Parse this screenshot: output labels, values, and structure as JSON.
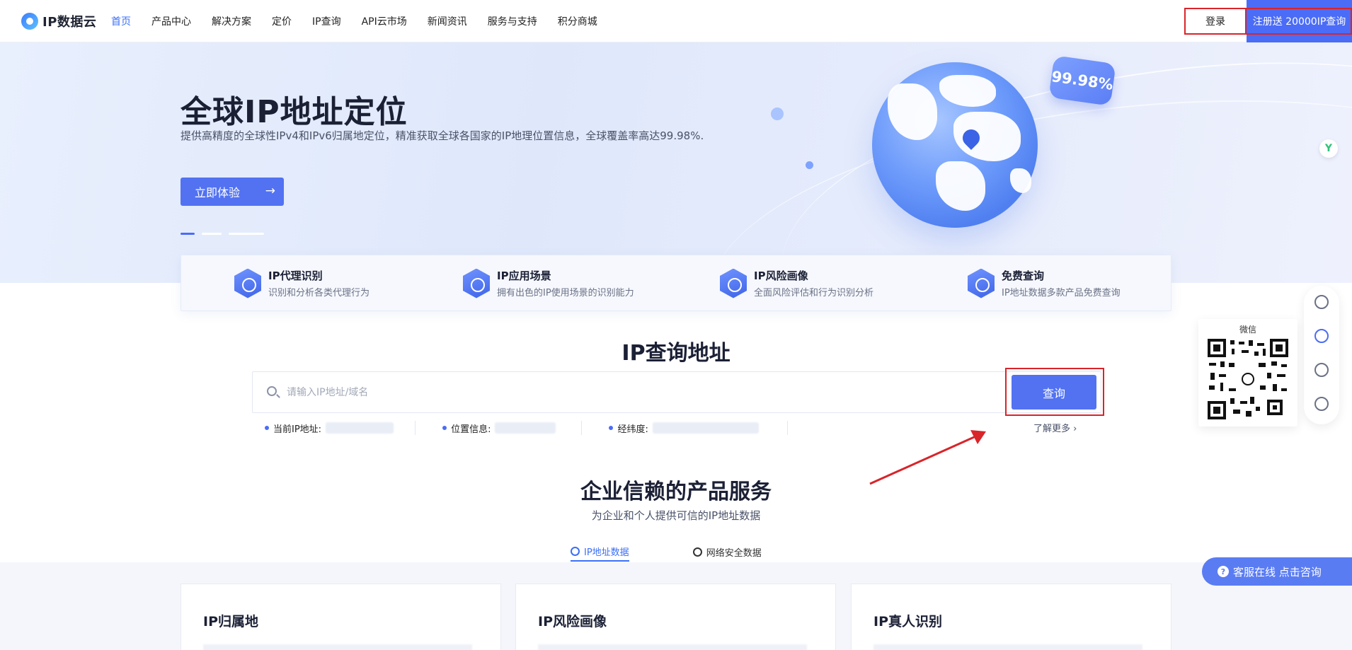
{
  "nav": {
    "logo_text": "IP数据云",
    "items": [
      {
        "label": "首页",
        "active": true
      },
      {
        "label": "产品中心"
      },
      {
        "label": "解决方案"
      },
      {
        "label": "定价"
      },
      {
        "label": "IP查询"
      },
      {
        "label": "API云市场"
      },
      {
        "label": "新闻资讯"
      },
      {
        "label": "服务与支持"
      },
      {
        "label": "积分商城"
      }
    ],
    "login": "登录",
    "register": "注册送 20000IP查询"
  },
  "hero": {
    "title": "全球IP地址定位",
    "subtitle": "提供高精度的全球性IPv4和IPv6归属地定位，精准获取全球各国家的IP地理位置信息，全球覆盖率高达99.98%.",
    "cta": "立即体验",
    "badge": "99.98%"
  },
  "features": [
    {
      "title": "IP代理识别",
      "desc": "识别和分析各类代理行为"
    },
    {
      "title": "IP应用场景",
      "desc": "拥有出色的IP使用场景的识别能力"
    },
    {
      "title": "IP风险画像",
      "desc": "全面风险评估和行为识别分析"
    },
    {
      "title": "免费查询",
      "desc": "IP地址数据多款产品免费查询"
    }
  ],
  "query": {
    "title": "IP查询地址",
    "placeholder": "请输入IP地址/域名",
    "button": "查询",
    "current_ip_label": "当前IP地址:",
    "location_label": "位置信息:",
    "latlng_label": "经纬度:",
    "learn_more": "了解更多"
  },
  "products": {
    "title": "企业信赖的产品服务",
    "subtitle": "为企业和个人提供可信的IP地址数据",
    "tabs": [
      {
        "label": "IP地址数据",
        "active": true
      },
      {
        "label": "网络安全数据"
      }
    ],
    "cards": [
      "IP归属地",
      "IP风险画像",
      "IP真人识别"
    ]
  },
  "side": {
    "qr_label": "微信",
    "online": "客服在线 点击咨询"
  },
  "colors": {
    "accent": "#4b6cf7",
    "annotation_red": "#d9242a"
  }
}
